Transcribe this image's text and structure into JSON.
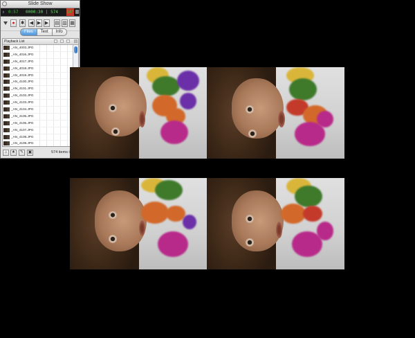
{
  "window": {
    "title": "Slide Show"
  },
  "readout": {
    "left": "0:57",
    "center": "0000:30 | 574",
    "right": "14\""
  },
  "toolbar": {
    "icons": [
      "stop-icon",
      "gear-icon",
      "previous-icon",
      "play-icon",
      "next-icon",
      "view-single-icon",
      "view-zoom-icon",
      "view-grid-icon"
    ],
    "glyphs": [
      "⬛",
      "✱",
      "◀",
      "▶",
      "▶",
      "▤",
      "▥",
      "▦"
    ]
  },
  "tabs": [
    {
      "label": "Files",
      "active": true
    },
    {
      "label": "Text",
      "active": false
    },
    {
      "label": "Info",
      "active": false
    }
  ],
  "playlist": {
    "header": "Playback List",
    "items": [
      "_AN_4003.JPG",
      "_AN_4016.JPG",
      "_AN_4017.JPG",
      "_AN_4018.JPG",
      "_AN_4019.JPG",
      "_AN_4100.JPG",
      "_AN_4101.JPG",
      "_AN_4102.JPG",
      "_AN_4103.JPG",
      "_AN_4104.JPG",
      "_AN_4105.JPG",
      "_AN_4106.JPG",
      "_AN_4107.JPG",
      "_AN_4108.JPG",
      "_AN_4109.JPG",
      "_AN_4110.JPG",
      "_AN_4111.JPG"
    ],
    "count_text": "574 items in list"
  },
  "footer": {
    "icons": [
      "home-icon",
      "star-icon",
      "tag-icon",
      "edit-icon"
    ]
  },
  "slides": [
    {
      "name": "slide-1"
    },
    {
      "name": "slide-2"
    },
    {
      "name": "slide-3"
    },
    {
      "name": "slide-4"
    }
  ]
}
